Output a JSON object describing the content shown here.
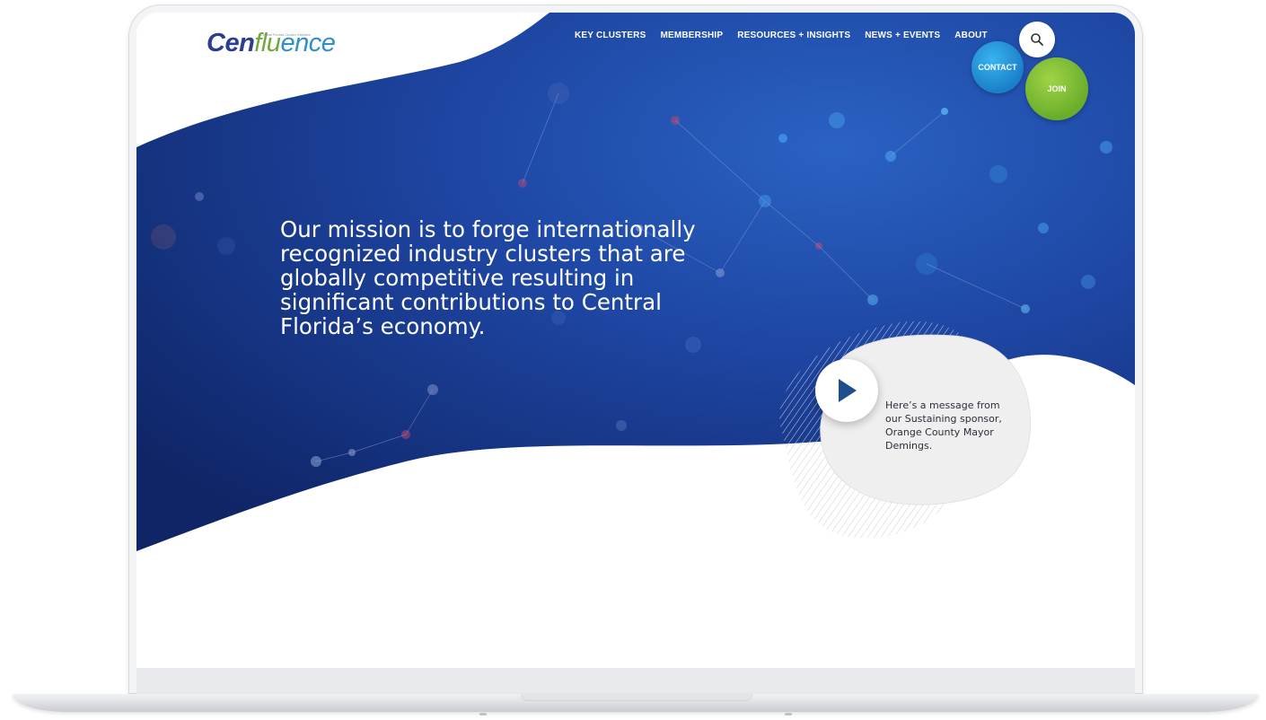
{
  "logo": {
    "main": "Cen",
    "flu": "flu",
    "rest": "ence",
    "tagline": "Central Florida Cluster Initiative"
  },
  "nav": {
    "items": [
      {
        "label": "KEY CLUSTERS"
      },
      {
        "label": "MEMBERSHIP"
      },
      {
        "label": "RESOURCES + INSIGHTS"
      },
      {
        "label": "NEWS + EVENTS"
      },
      {
        "label": "ABOUT"
      }
    ],
    "search_icon": "search-icon",
    "contact_label": "CONTACT",
    "join_label": "JOIN"
  },
  "hero": {
    "mission": "Our mission is to forge internationally recognized industry clusters that are globally competitive resulting in significant contributions to Central Florida’s economy.",
    "sponsor_message": "Here’s a message from our Sustaining sponsor, Orange County Mayor Demings.",
    "play_icon": "play-icon"
  },
  "colors": {
    "hero_dark": "#14296e",
    "hero_mid": "#1d49a6",
    "contact": "#1e8fd6",
    "join": "#7dbb35",
    "bubble": "#efefef"
  }
}
